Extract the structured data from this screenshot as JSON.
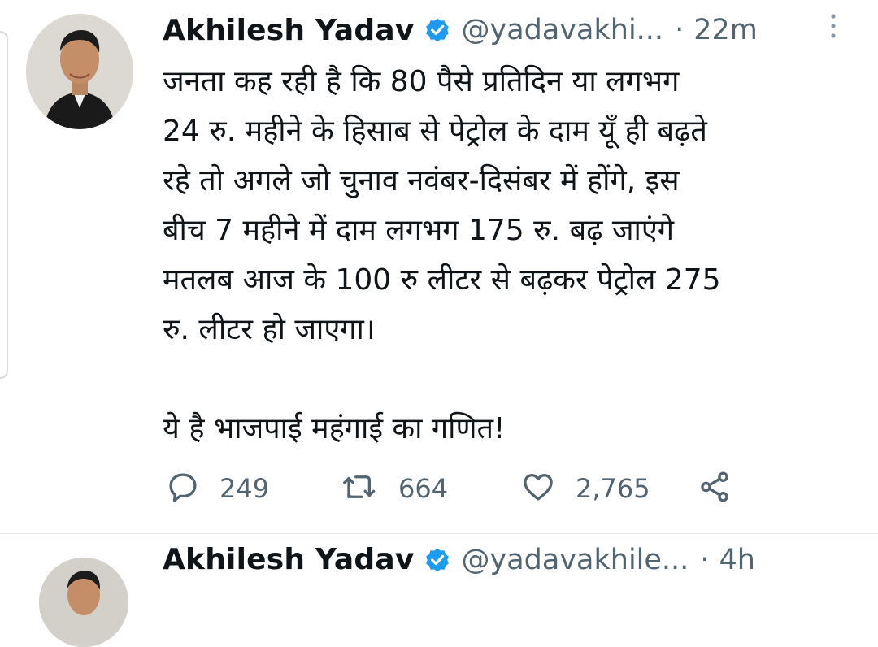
{
  "tweet": {
    "author_name": "Akhilesh Yadav",
    "handle": "@yadavakhi...",
    "separator": "·",
    "time": "22m",
    "body_lines": [
      "जनता कह रही है कि 80 पैसे प्रतिदिन या लगभग",
      "24 रु. महीने के हिसाब से पेट्रोल के दाम यूँ ही बढ़ते",
      "रहे तो अगले जो चुनाव नवंबर-दिसंबर में होंगे, इस",
      "बीच 7 महीने में दाम लगभग 175 रु. बढ़ जाएंगे",
      "मतलब आज के 100 रु लीटर से बढ़कर पेट्रोल 275",
      "रु. लीटर हो जाएगा।"
    ],
    "closing_line": "ये है भाजपाई महंगाई का गणित!",
    "replies": "249",
    "retweets": "664",
    "likes": "2,765"
  },
  "next_tweet": {
    "author_name": "Akhilesh Yadav",
    "handle": "@yadavakhile...",
    "time": "4h"
  },
  "icons": {
    "verified": "verified-badge-icon",
    "more": "more-vertical-icon",
    "reply": "reply-icon",
    "retweet": "retweet-icon",
    "like": "heart-icon",
    "share": "share-icon"
  },
  "colors": {
    "text": "#0f1419",
    "secondary": "#536471",
    "verified": "#1d9bf0"
  }
}
